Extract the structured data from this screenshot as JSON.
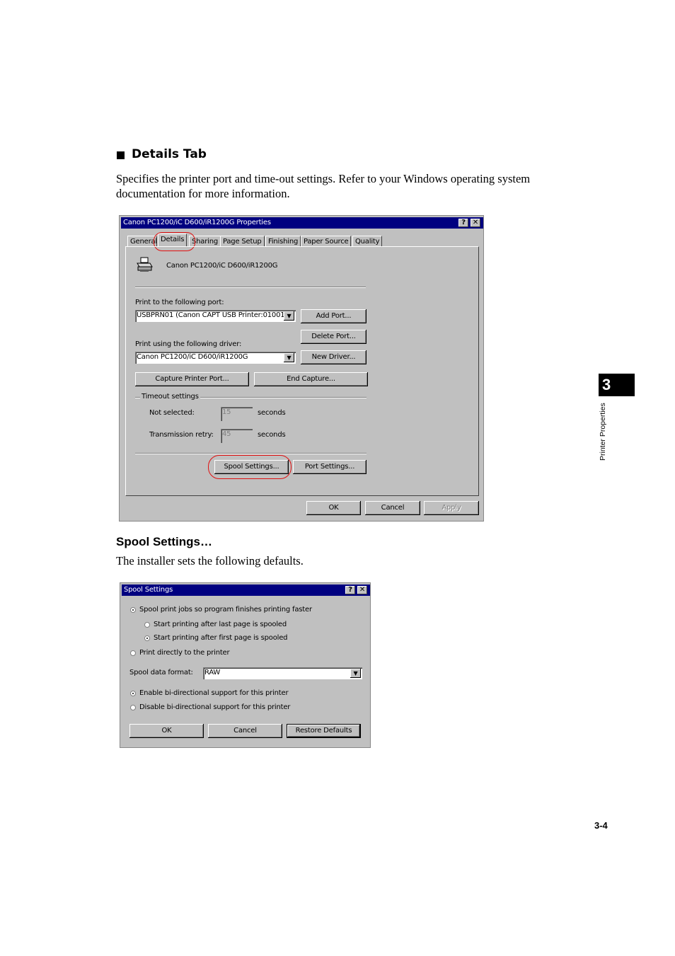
{
  "section": {
    "heading": "Details Tab",
    "description": "Specifies the printer port and time-out settings. Refer to your Windows operating system documentation for more information."
  },
  "props_dialog": {
    "title": "Canon PC1200/iC D600/iR1200G Properties",
    "help_btn": "?",
    "close_btn": "✕",
    "tabs": [
      "General",
      "Details",
      "Sharing",
      "Page Setup",
      "Finishing",
      "Paper Source",
      "Quality"
    ],
    "printer_name": "Canon PC1200/iC D600/iR1200G",
    "port_label": "Print to the following port:",
    "port_value": "USBPRN01  (Canon CAPT USB Printer:01001",
    "add_port": "Add Port...",
    "delete_port": "Delete Port...",
    "driver_label": "Print using the following driver:",
    "driver_value": "Canon PC1200/iC D600/iR1200G",
    "new_driver": "New Driver...",
    "capture_port": "Capture Printer Port...",
    "end_capture": "End Capture...",
    "timeout_group": "Timeout settings",
    "not_selected_label": "Not selected:",
    "not_selected_value": "15",
    "retry_label": "Transmission retry:",
    "retry_value": "45",
    "seconds": "seconds",
    "spool_settings": "Spool Settings...",
    "port_settings": "Port Settings...",
    "ok": "OK",
    "cancel": "Cancel",
    "apply": "Apply"
  },
  "spool_section": {
    "heading": "Spool Settings…",
    "description": "The installer sets the following defaults."
  },
  "spool_dialog": {
    "title": "Spool Settings",
    "help_btn": "?",
    "close_btn": "✕",
    "opt_spool": "Spool print jobs so program finishes printing faster",
    "opt_last_page": "Start printing after last page is spooled",
    "opt_first_page": "Start printing after first page is spooled",
    "opt_direct": "Print directly to the printer",
    "format_label": "Spool data format:",
    "format_value": "RAW",
    "opt_enable_bidi": "Enable bi-directional support for this printer",
    "opt_disable_bidi": "Disable bi-directional support for this printer",
    "ok": "OK",
    "cancel": "Cancel",
    "restore": "Restore Defaults"
  },
  "sidebar": {
    "chapter_number": "3",
    "chapter_title": "Printer Properties"
  },
  "page_number": "3-4"
}
